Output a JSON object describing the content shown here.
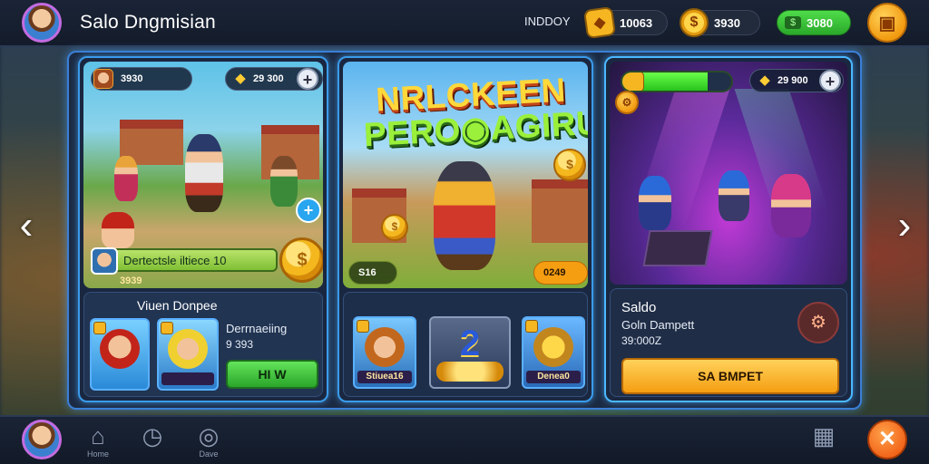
{
  "header": {
    "title": "Salo Dngmisian",
    "level_text": "INDDOY",
    "gems": "10063",
    "coins": "3930",
    "cash": "3080"
  },
  "cards": [
    {
      "stat": "3930",
      "resource": "29 300",
      "quest_text": "Dertectsle iltiece 10",
      "quest_sub": "3939",
      "panel_title": "Viuen Donpee",
      "panel_info": "Derrnaeiing",
      "panel_sub": "9 393",
      "button_label": "HI W",
      "tile_captions": [
        "",
        ""
      ]
    },
    {
      "logo_line1": "NRLCKEEN",
      "logo_line2": "PERO◉AGIRU",
      "left_value": "S16",
      "right_value": "0249",
      "tiles": [
        {
          "caption": "Stiuea16"
        },
        {
          "caption": "2"
        },
        {
          "caption": "Denea0"
        }
      ]
    },
    {
      "resource": "29 900",
      "progress": 0.78,
      "panel_title": "Saldo",
      "panel_subtitle": "Goln Dampett",
      "panel_value": "39:000Z",
      "button_label": "SA BMPET"
    }
  ],
  "bottom_nav": {
    "home_label": "Home",
    "history_label": "",
    "game_label": "Dave"
  },
  "icons": {
    "gems": "gem-icon",
    "coins": "coin-icon",
    "cash": "cash-icon",
    "shop": "shop-icon",
    "close": "close-icon",
    "arrow_left": "chevron-left-icon",
    "arrow_right": "chevron-right-icon",
    "home": "home-icon",
    "history": "clock-icon",
    "game": "gamepad-icon",
    "grid": "grid-icon"
  },
  "colors": {
    "accent_blue": "#3a9bea",
    "green": "#2aa62a",
    "orange": "#f59e12",
    "top_bar": "#141c2b"
  }
}
